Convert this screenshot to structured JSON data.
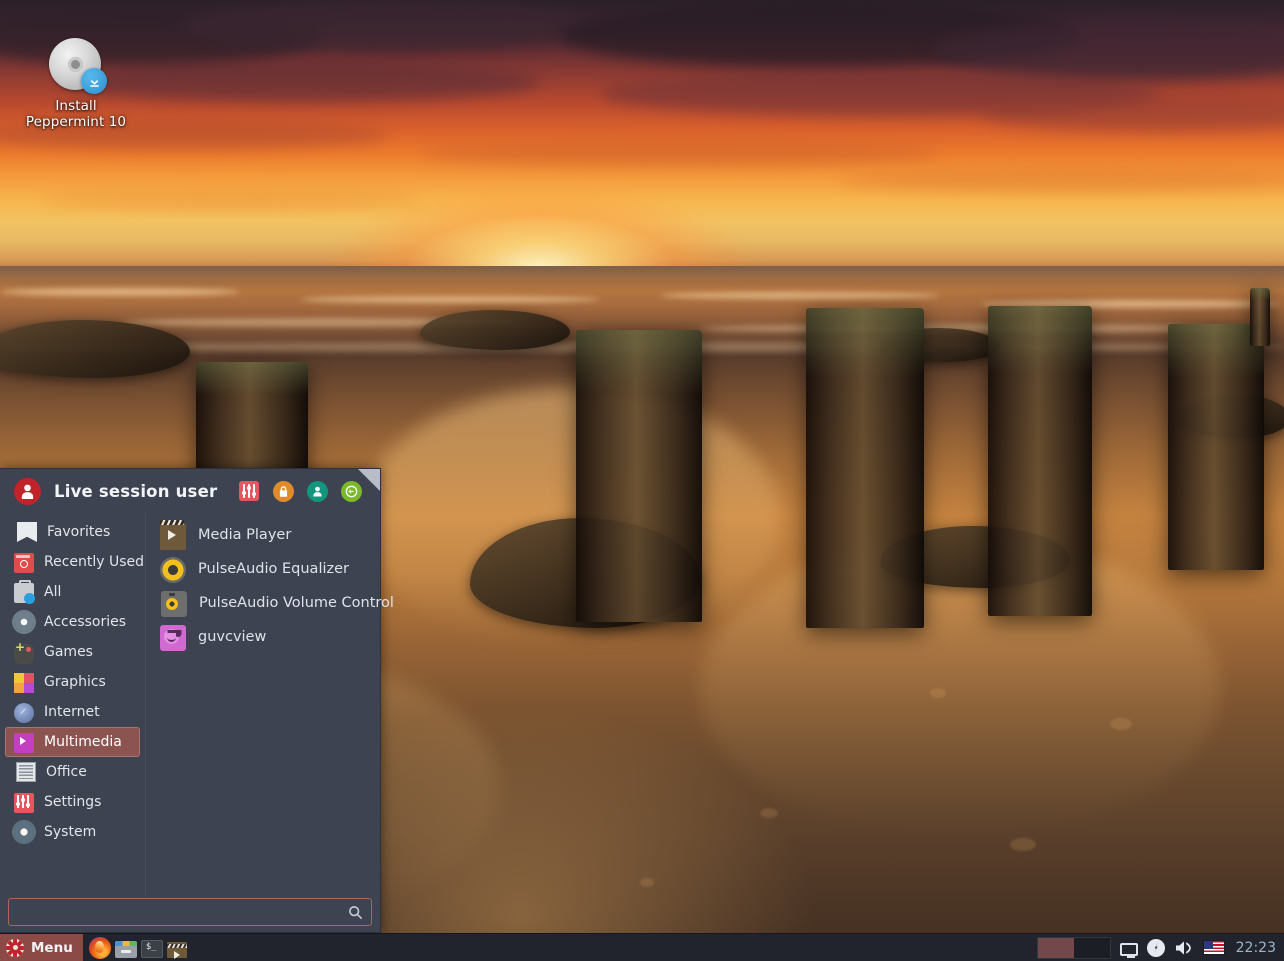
{
  "desktop": {
    "icon": {
      "name": "install-peppermint-icon",
      "label_line1": "Install",
      "label_line2": "Peppermint 10",
      "glyph": "disc-with-download-badge"
    }
  },
  "menu": {
    "username": "Live session user",
    "header_buttons": [
      {
        "name": "settings-manager-icon",
        "label": "Settings Manager"
      },
      {
        "name": "lock-screen-icon",
        "label": "Lock Screen"
      },
      {
        "name": "log-out-icon",
        "label": "Log Out"
      },
      {
        "name": "power-icon",
        "label": "Shut Down"
      }
    ],
    "categories": [
      {
        "label": "Favorites",
        "icon": "bookmark-icon",
        "selected": false
      },
      {
        "label": "Recently Used",
        "icon": "history-icon",
        "selected": false
      },
      {
        "label": "All",
        "icon": "all-apps-icon",
        "selected": false
      },
      {
        "label": "Accessories",
        "icon": "gear-icon",
        "selected": false
      },
      {
        "label": "Games",
        "icon": "gamepad-icon",
        "selected": false
      },
      {
        "label": "Graphics",
        "icon": "palette-icon",
        "selected": false
      },
      {
        "label": "Internet",
        "icon": "compass-icon",
        "selected": false
      },
      {
        "label": "Multimedia",
        "icon": "play-icon",
        "selected": true
      },
      {
        "label": "Office",
        "icon": "document-icon",
        "selected": false
      },
      {
        "label": "Settings",
        "icon": "sliders-icon",
        "selected": false
      },
      {
        "label": "System",
        "icon": "system-gear-icon",
        "selected": false
      }
    ],
    "apps": [
      {
        "label": "Media Player",
        "icon": "clapperboard-icon"
      },
      {
        "label": "PulseAudio Equalizer",
        "icon": "pulseaudio-icon"
      },
      {
        "label": "PulseAudio Volume Control",
        "icon": "pulseaudio-volume-icon"
      },
      {
        "label": "guvcview",
        "icon": "webcam-icon"
      }
    ],
    "search": {
      "value": "",
      "placeholder": "",
      "icon": "search-icon"
    },
    "resize_grip": "resize-grip"
  },
  "taskbar": {
    "menu_label": "Menu",
    "menu_icon": "peppermint-logo-icon",
    "launchers": [
      {
        "name": "firefox-launcher",
        "label": "Firefox"
      },
      {
        "name": "file-manager-launcher",
        "label": "File Manager"
      },
      {
        "name": "terminal-launcher",
        "label": "Terminal"
      },
      {
        "name": "media-player-launcher",
        "label": "Media Player"
      }
    ],
    "workspaces": [
      {
        "name": "workspace-1",
        "active": true
      },
      {
        "name": "workspace-2",
        "active": false
      }
    ],
    "tray": [
      {
        "name": "display-icon",
        "label": "Display Settings"
      },
      {
        "name": "power-manager-icon",
        "label": "Power Manager"
      },
      {
        "name": "volume-icon",
        "label": "Volume"
      },
      {
        "name": "keyboard-layout-flag-icon",
        "label": "US"
      }
    ],
    "clock": "22:23"
  },
  "colors": {
    "menu_bg": "#3d4350",
    "menu_selected": "#8c5450",
    "taskbar_bg": "#21242c",
    "menu_button_bg": "#8c4a47",
    "search_border": "#b4615c",
    "clock_text": "#9fb4c9",
    "accent_red": "#c0242a"
  }
}
